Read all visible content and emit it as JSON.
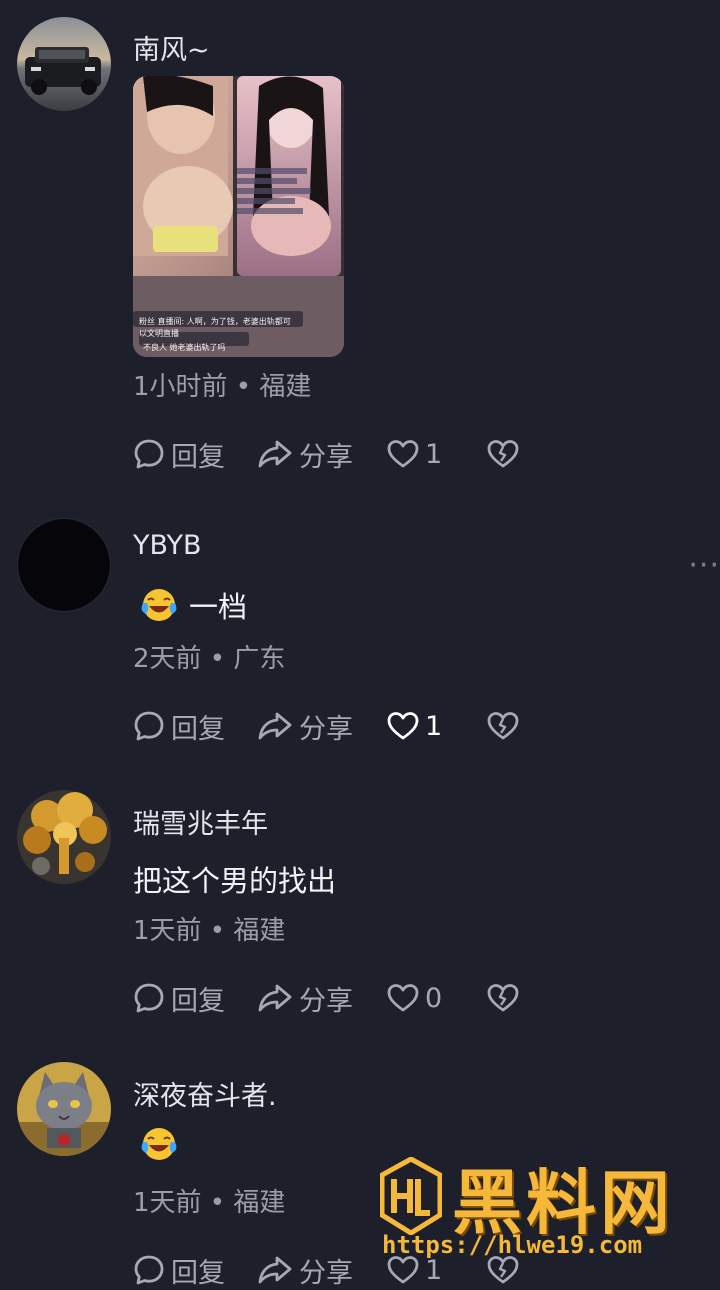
{
  "comments": [
    {
      "username": "南风~",
      "text": "",
      "meta": "1小时前 • 福建",
      "actions": {
        "reply": "回复",
        "share": "分享",
        "likes": "1"
      },
      "image_overlay": {
        "line1": "粉丝 直播间: 人啊，为了钱，老婆出轨都可",
        "line2": "以文明直播",
        "line3": "不良人  她老婆出轨了吗"
      }
    },
    {
      "username": "YBYB",
      "text": "一档",
      "meta": "2天前 • 广东",
      "actions": {
        "reply": "回复",
        "share": "分享",
        "likes": "1"
      }
    },
    {
      "username": "瑞雪兆丰年",
      "text": "把这个男的找出",
      "meta": "1天前 • 福建",
      "actions": {
        "reply": "回复",
        "share": "分享",
        "likes": "0"
      }
    },
    {
      "username": "深夜奋斗者.",
      "text": "",
      "meta": "1天前 • 福建",
      "actions": {
        "reply": "回复",
        "share": "分享",
        "likes": "1"
      }
    }
  ],
  "more_label": "···",
  "watermark": {
    "brand": "黑料网",
    "url": "https://hlwe19.com"
  },
  "colors": {
    "background": "#1d1f2b",
    "text_primary": "#f2f2f6",
    "text_secondary": "#9c9dab",
    "watermark": "#f5b83a"
  }
}
